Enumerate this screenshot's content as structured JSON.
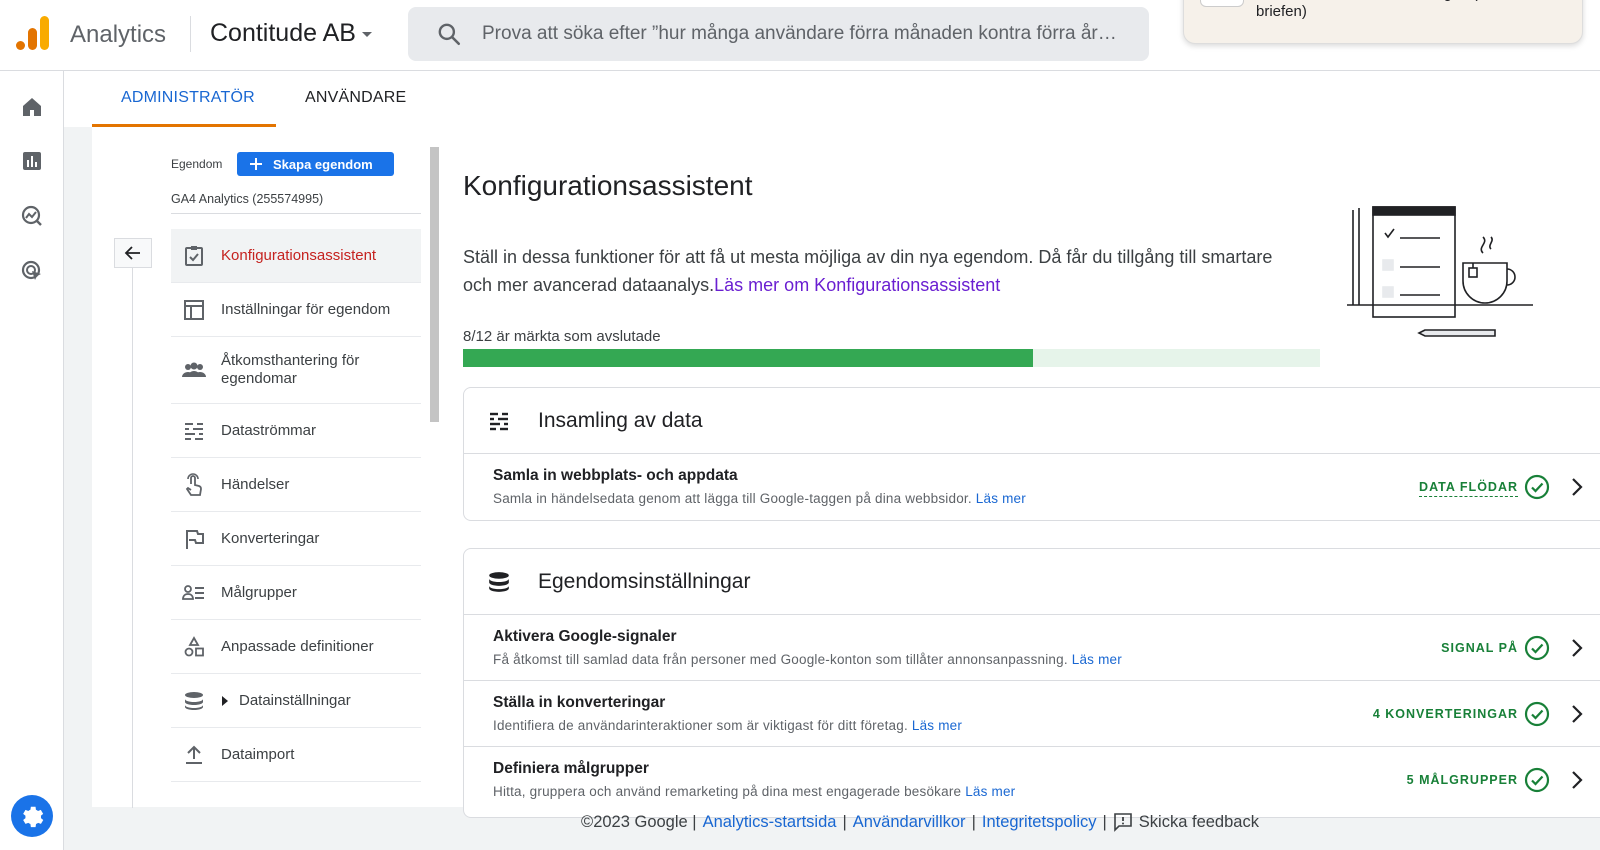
{
  "topbar": {
    "app_title": "Analytics",
    "account_name": "Contitude AB",
    "search_placeholder": "Prova att söka efter ”hur många användare förra månaden kontra förra år…",
    "toast_text": "annonsera i Baltikum för norgen (står även i briefen)"
  },
  "tabs": [
    {
      "label": "ADMINISTRATÖR",
      "active": true
    },
    {
      "label": "ANVÄNDARE",
      "active": false
    }
  ],
  "property": {
    "label": "Egendom",
    "create_button": "Skapa egendom",
    "name": "GA4 Analytics (255574995)"
  },
  "nav_items": [
    {
      "label": "Konfigurationsassistent",
      "icon": "checklist-icon",
      "active": true
    },
    {
      "label": "Inställningar för egendom",
      "icon": "layout-icon"
    },
    {
      "label": "Åtkomsthantering för egendomar",
      "icon": "people-icon"
    },
    {
      "label": "Dataströmmar",
      "icon": "streams-icon"
    },
    {
      "label": "Händelser",
      "icon": "touch-icon"
    },
    {
      "label": "Konverteringar",
      "icon": "flag-icon"
    },
    {
      "label": "Målgrupper",
      "icon": "audience-icon"
    },
    {
      "label": "Anpassade definitioner",
      "icon": "shapes-icon"
    },
    {
      "label": "Datainställningar",
      "icon": "database-icon",
      "expandable": true
    },
    {
      "label": "Dataimport",
      "icon": "upload-icon"
    }
  ],
  "main": {
    "title": "Konfigurationsassistent",
    "intro": "Ställ in dessa funktioner för att få ut mesta möjliga av din nya egendom. Då får du tillgång till smartare och mer avancerad dataanalys.",
    "intro_link": "Läs mer om Konfigurationsassistent",
    "progress_label": "8/12 är märkta som avslutade",
    "progress_done": 8,
    "progress_total": 12
  },
  "cards": [
    {
      "title": "Insamling av data",
      "icon": "streams-icon",
      "rows": [
        {
          "title": "Samla in webbplats- och appdata",
          "desc": "Samla in händelsedata genom att lägga till Google-taggen på dina webbsidor.",
          "link": "Läs mer",
          "status": "DATA FLÖDAR",
          "dashed": true
        }
      ]
    },
    {
      "title": "Egendomsinställningar",
      "icon": "database-icon",
      "rows": [
        {
          "title": "Aktivera Google-signaler",
          "desc": "Få åtkomst till samlad data från personer med Google-konton som tillåter annonsanpassning.",
          "link": "Läs mer",
          "status": "SIGNAL PÅ"
        },
        {
          "title": "Ställa in konverteringar",
          "desc": "Identifiera de användarinteraktioner som är viktigast för ditt företag.",
          "link": "Läs mer",
          "status": "4 KONVERTERINGAR"
        },
        {
          "title": "Definiera målgrupper",
          "desc": "Hitta, gruppera och använd remarketing på dina mest engagerade besökare",
          "link": "Läs mer",
          "status": "5 MÅLGRUPPER"
        }
      ]
    }
  ],
  "footer": {
    "copyright": "©2023 Google |",
    "link_home": "Analytics-startsida",
    "link_terms": "Användarvillkor",
    "link_privacy": "Integritetspolicy",
    "sep": "|",
    "feedback": "Skicka feedback"
  },
  "colors": {
    "accent_blue": "#1a73e8",
    "active_red": "#c5221f",
    "success_green": "#188038",
    "progress_green": "#34a853",
    "tab_orange": "#e37400"
  }
}
